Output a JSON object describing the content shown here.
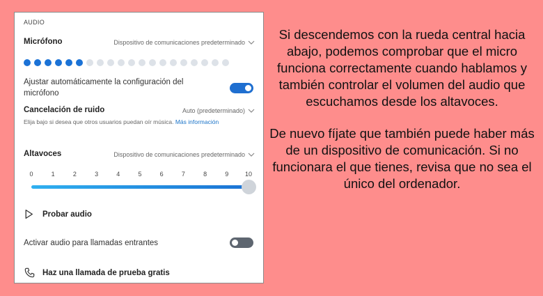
{
  "panel": {
    "section_title": "AUDIO",
    "microphone": {
      "label": "Micrófono",
      "device": "Dispositivo de comunicaciones predeterminado",
      "level": {
        "active_dots": 6,
        "total_dots": 20
      }
    },
    "auto_adjust": {
      "label": "Ajustar automáticamente la configuración del micrófono",
      "enabled": true
    },
    "noise_cancel": {
      "label": "Cancelación de ruido",
      "value": "Auto (predeterminado)",
      "hint": "Elija bajo si desea que otros usuarios puedan oír música.",
      "hint_link": "Más información"
    },
    "speakers": {
      "label": "Altavoces",
      "device": "Dispositivo de comunicaciones predeterminado",
      "scale": [
        "0",
        "1",
        "2",
        "3",
        "4",
        "5",
        "6",
        "7",
        "8",
        "9",
        "10"
      ],
      "volume": 10
    },
    "test_audio": {
      "label": "Probar audio",
      "icon": "play-icon"
    },
    "incoming_audio": {
      "label": "Activar audio para llamadas entrantes",
      "enabled": false
    },
    "test_call": {
      "label": "Haz una llamada de prueba gratis",
      "icon": "phone-icon"
    }
  },
  "explanation": {
    "paragraph1": "Si descendemos con la rueda central hacia abajo, podemos comprobar que el micro funciona correctamente cuando hablamos y también controlar el volumen del audio que escuchamos desde los altavoces.",
    "paragraph2": "De nuevo fíjate que también puede haber más de un dispositivo de comunicación. Si no funcionara el que tienes, revisa que no sea el único del ordenador."
  },
  "colors": {
    "background": "#fe8d8c",
    "accent": "#1b72d6"
  }
}
